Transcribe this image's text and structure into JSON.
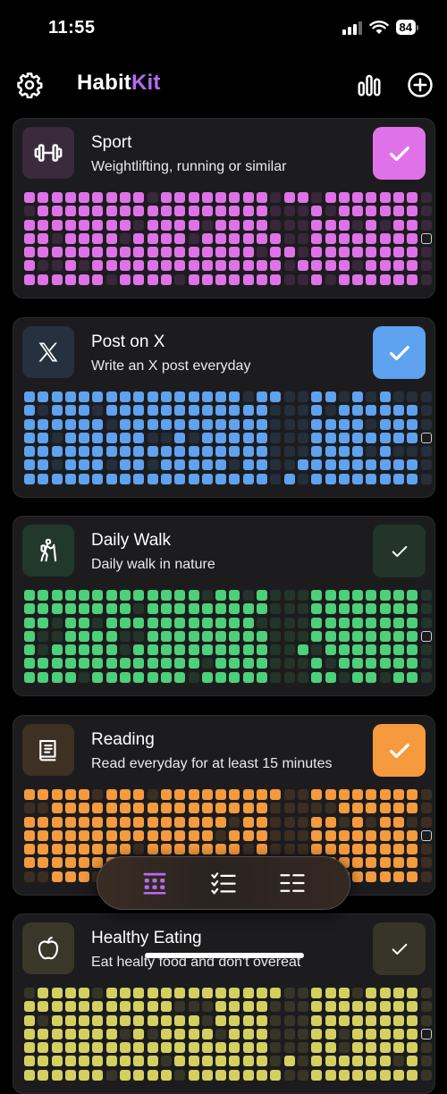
{
  "status_bar": {
    "time": "11:55",
    "battery": "84"
  },
  "header": {
    "logo_a": "Habit",
    "logo_b": "Kit",
    "logo_accent": "#b66bf2",
    "settings_icon": "gear-icon",
    "stats_icon": "bar-chart-icon",
    "add_icon": "plus-circle-icon"
  },
  "habits": [
    {
      "name": "Sport",
      "description": "Weightlifting, running or similar",
      "icon": "dumbbell-icon",
      "color": "#e072e9",
      "completed_today": true
    },
    {
      "name": "Post on X",
      "description": "Write an X post everyday",
      "icon": "x-logo-icon",
      "color": "#5ea2f0",
      "completed_today": true
    },
    {
      "name": "Daily Walk",
      "description": "Daily walk in nature",
      "icon": "hiker-icon",
      "color": "#4cd07a",
      "completed_today": false
    },
    {
      "name": "Reading",
      "description": "Read everyday for at least 15 minutes",
      "icon": "book-icon",
      "color": "#f59a3d",
      "completed_today": true
    },
    {
      "name": "Healthy Eating",
      "description": "Eat healty food and don't overeat",
      "icon": "apple-icon",
      "color": "#d4d060",
      "completed_today": false
    }
  ],
  "bottom_nav": [
    {
      "name": "grid-view-icon",
      "active": true
    },
    {
      "name": "checklist-icon",
      "active": false
    },
    {
      "name": "list-view-icon",
      "active": false
    }
  ]
}
